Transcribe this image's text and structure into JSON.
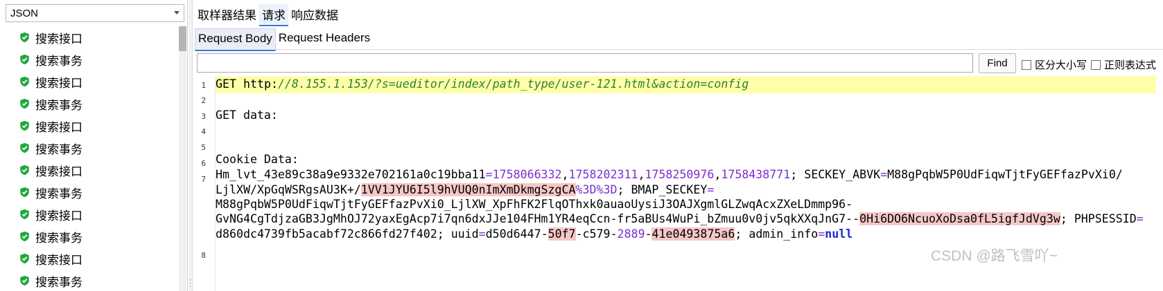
{
  "left_panel": {
    "renderer_select": "JSON",
    "tree_items": [
      "搜索接口",
      "搜索事务",
      "搜索接口",
      "搜索事务",
      "搜索接口",
      "搜索事务",
      "搜索接口",
      "搜索事务",
      "搜索接口",
      "搜索事务",
      "搜索接口",
      "搜索事务"
    ],
    "icon": "green-shield-check-icon"
  },
  "tabs": [
    "取样器结果",
    "请求",
    "响应数据"
  ],
  "active_tab": "请求",
  "sub_tabs": [
    "Request Body",
    "Request Headers"
  ],
  "active_sub_tab": "Request Body",
  "search": {
    "value": "",
    "find_label": "Find",
    "case_label": "区分大小写",
    "regex_label": "正则表达式"
  },
  "editor": {
    "line_numbers": [
      "1",
      "2",
      "3",
      "4",
      "5",
      "6",
      "7",
      "8"
    ],
    "line1_method": "GET",
    "line1_url_host": "http:",
    "line1_url_path": "//8.155.1.153/?s=ueditor/index/path_type/user-121.html&action=config",
    "line3": "GET data:",
    "line6": "Cookie Data:",
    "cookie": {
      "hm_name": "Hm_lvt_43e89c38a9e9332e702161a0c19bba11",
      "hm_values": [
        "1758066332",
        "1758202311",
        "1758250976",
        "1758438771"
      ],
      "seckey_name": "SECKEY_ABVK",
      "seckey_value_part1": "M88gPqbW5P0UdFiqwTjtFyGEFfazPvXi0/",
      "seckey_value_part2": "LjlXW/XpGqWSRgsAU3K+/",
      "seckey_value_hl": "1VV1JYU6I5l9hVUQ0nImXmDkmgSzgCA",
      "seckey_value_pct": "%3D%3D",
      "bmap_name": "BMAP_SECKEY",
      "bmap_value_line1": "M88gPqbW5P0UdFiqwTjtFyGEFfazPvXi0_LjlXW_XpFhFK2FlqOThxk0auaoUysiJ3OAJXgmlGLZwqAcxZXeLDmmp96-",
      "bmap_value_line2a": "GvNG4CgTdjzaGB3JgMhOJ72yaxEgAcp7i7qn6dxJJe104FHm1YR4eqCcn-fr5aBUs4WuPi_bZmuu0v0jv5qkXXqJnG7--",
      "bmap_value_hl": "0Hi6DO6NcuoXoDsa0fL5igfJdVg3w",
      "phpsessid_name": "PHPSESSID",
      "phpsessid_value": "d860dc4739fb5acabf72c866fd27f402",
      "uuid_name": "uuid",
      "uuid_a": "d50d6447-",
      "uuid_b": "50f7",
      "uuid_c": "-c579-",
      "uuid_d": "2889",
      "uuid_e": "-",
      "uuid_f": "41e0493875a6",
      "admin_name": "admin_info",
      "admin_value": "null"
    }
  },
  "watermark": "CSDN @路飞雪吖~"
}
